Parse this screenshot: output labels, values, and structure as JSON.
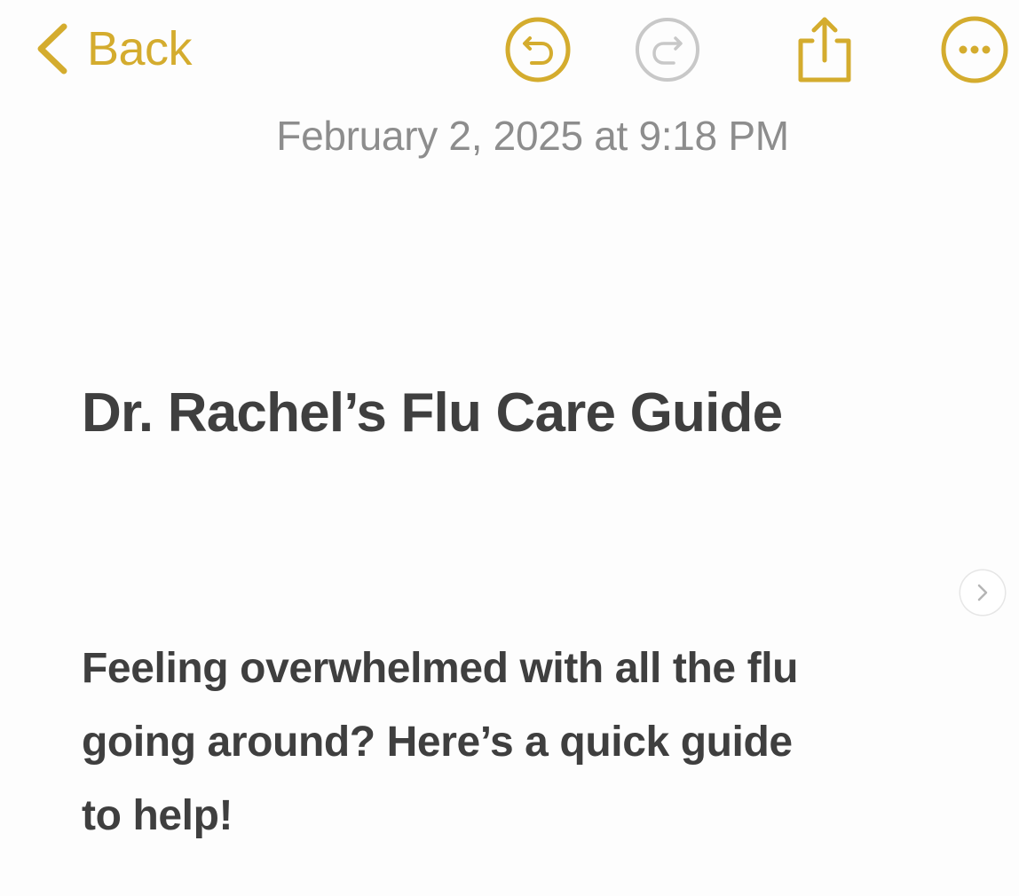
{
  "toolbar": {
    "back_label": "Back",
    "icons": {
      "back": "chevron-left-icon",
      "undo": "undo-icon",
      "redo": "redo-icon",
      "share": "share-icon",
      "more": "more-icon"
    },
    "redo_enabled": false
  },
  "note": {
    "timestamp": "February 2, 2025 at 9:18 PM",
    "title": "Dr. Rachel’s Flu Care Guide",
    "body_lines": [
      "Feeling overwhelmed with all the flu",
      "going around? Here’s a quick guide",
      "to help!"
    ]
  },
  "colors": {
    "accent": "#d4ac2e",
    "disabled": "#c8c8c8",
    "text": "#3f3f3f",
    "meta": "#8d8d8d",
    "background": "#fdfdfd"
  }
}
